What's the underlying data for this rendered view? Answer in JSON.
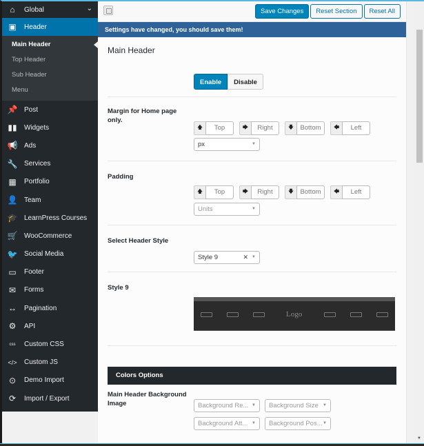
{
  "sidebar": {
    "global": {
      "label": "Global",
      "icon": "home-icon"
    },
    "header": {
      "label": "Header",
      "icon": "header-icon"
    },
    "sub_items": [
      {
        "label": "Main Header",
        "current": true
      },
      {
        "label": "Top Header"
      },
      {
        "label": "Sub Header"
      },
      {
        "label": "Menu"
      }
    ],
    "items": [
      {
        "label": "Post",
        "icon": "pin-icon",
        "glyph": "📌"
      },
      {
        "label": "Widgets",
        "icon": "widgets-icon",
        "glyph": "▮▮"
      },
      {
        "label": "Ads",
        "icon": "megaphone-icon",
        "glyph": "📢"
      },
      {
        "label": "Services",
        "icon": "wrench-icon",
        "glyph": "🔧"
      },
      {
        "label": "Portfolio",
        "icon": "grid-icon",
        "glyph": "▦"
      },
      {
        "label": "Team",
        "icon": "user-icon",
        "glyph": "👤"
      },
      {
        "label": "LearnPress Courses",
        "icon": "graduation-cap-icon",
        "glyph": "🎓"
      },
      {
        "label": "WooCommerce",
        "icon": "cart-icon",
        "glyph": "🛒"
      },
      {
        "label": "Social Media",
        "icon": "twitter-icon",
        "glyph": "🐦"
      },
      {
        "label": "Footer",
        "icon": "footer-icon",
        "glyph": "▭"
      },
      {
        "label": "Forms",
        "icon": "envelope-icon",
        "glyph": "✉"
      },
      {
        "label": "Pagination",
        "icon": "arrows-horizontal-icon",
        "glyph": "↔"
      },
      {
        "label": "API",
        "icon": "gears-icon",
        "glyph": "⚙"
      },
      {
        "label": "Custom CSS",
        "icon": "css-icon",
        "glyph": "css"
      },
      {
        "label": "Custom JS",
        "icon": "code-icon",
        "glyph": "</>"
      },
      {
        "label": "Demo Import",
        "icon": "download-circle-icon",
        "glyph": "⊙"
      },
      {
        "label": "Import / Export",
        "icon": "refresh-icon",
        "glyph": "⟳"
      }
    ]
  },
  "toolbar": {
    "save_label": "Save Changes",
    "reset_section_label": "Reset Section",
    "reset_all_label": "Reset All"
  },
  "notice": "Settings have changed, you should save them!",
  "section_title": "Main Header",
  "fields": {
    "enable": {
      "on_label": "Enable",
      "off_label": "Disable",
      "value": "Enable"
    },
    "margin": {
      "label": "Margin for Home page only.",
      "top": "Top",
      "right": "Right",
      "bottom": "Bottom",
      "left": "Left",
      "unit": "px"
    },
    "padding": {
      "label": "Padding",
      "top": "Top",
      "right": "Right",
      "bottom": "Bottom",
      "left": "Left",
      "unit_placeholder": "Units"
    },
    "header_style": {
      "label": "Select Header Style",
      "value": "Style 9"
    },
    "style_preview": {
      "label": "Style 9",
      "logo_text": "Logo"
    }
  },
  "colors_options": {
    "title": "Colors Options",
    "bg_image_label": "Main Header Background Image",
    "selects": [
      "Background Re...",
      "Background Size",
      "Background Att...",
      "Background Pos..."
    ]
  }
}
